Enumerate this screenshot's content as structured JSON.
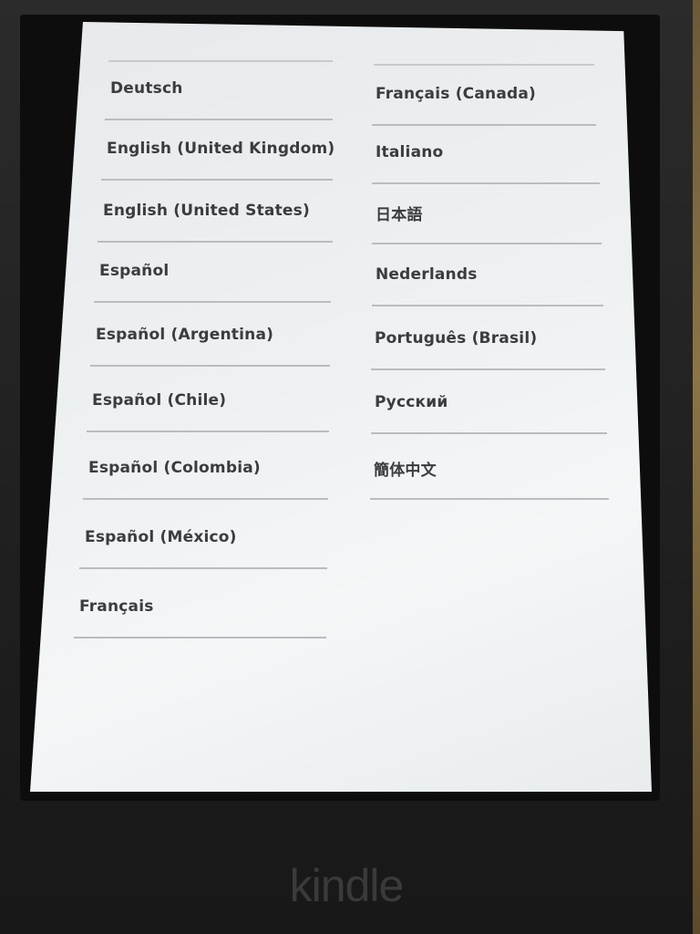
{
  "left_column": [
    "Deutsch",
    "English (United Kingdom)",
    "English (United States)",
    "Español",
    "Español (Argentina)",
    "Español (Chile)",
    "Español (Colombia)",
    "Español (México)",
    "Français"
  ],
  "right_column": [
    "Français (Canada)",
    "Italiano",
    "日本語",
    "Nederlands",
    "Português (Brasil)",
    "Русский",
    "簡体中文"
  ],
  "device": {
    "brand": "kindle"
  }
}
